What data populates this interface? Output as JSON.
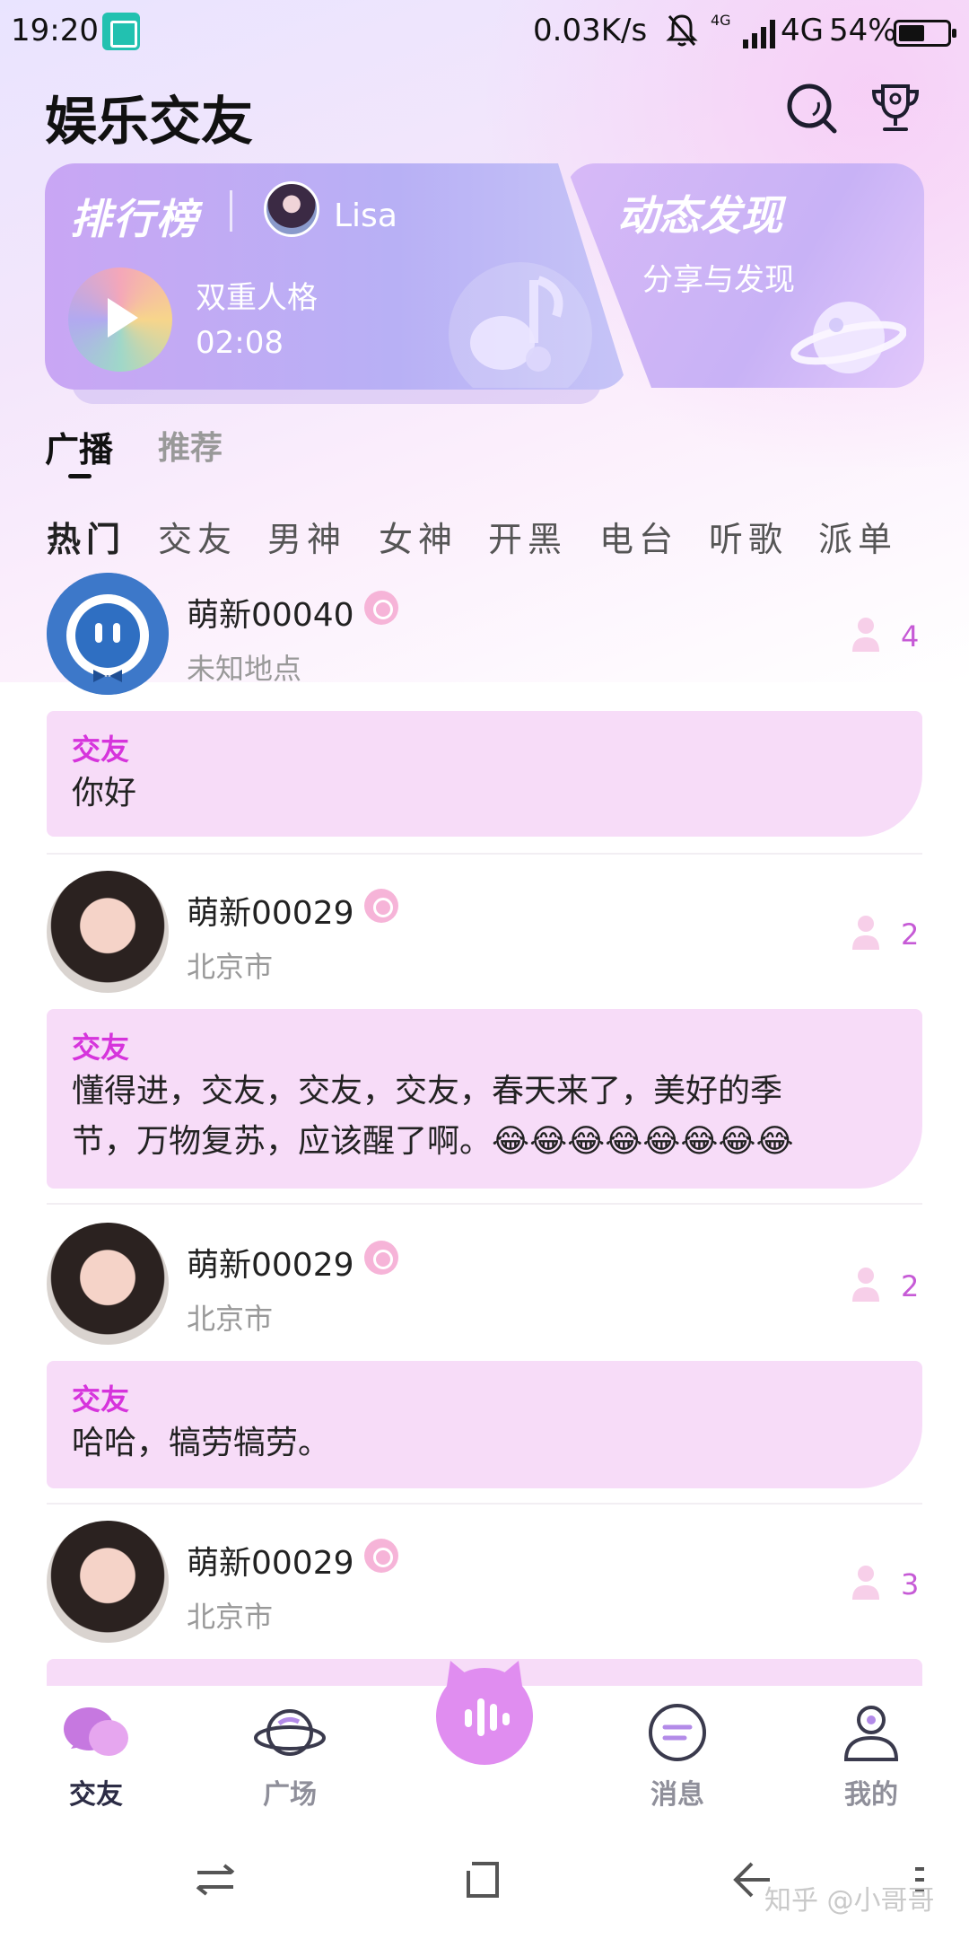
{
  "status_bar": {
    "time": "19:20",
    "net_speed": "0.03K/s",
    "net_small": "4G",
    "network": "4G",
    "battery_pct": "54%",
    "battery_level": 0.54
  },
  "header": {
    "title": "娱乐交友",
    "icons": [
      "search-icon",
      "trophy-icon"
    ]
  },
  "banner": {
    "rank": {
      "title": "排行榜",
      "user": "Lisa",
      "song": "双重人格",
      "duration": "02:08"
    },
    "discover": {
      "title": "动态发现",
      "subtitle": "分享与发现"
    }
  },
  "tabs": [
    {
      "label": "广播",
      "active": true
    },
    {
      "label": "推荐",
      "active": false
    }
  ],
  "categories": [
    "热门",
    "交友",
    "男神",
    "女神",
    "开黑",
    "电台",
    "听歌",
    "派单"
  ],
  "posts": [
    {
      "username": "萌新00040",
      "location": "未知地点",
      "count": "4",
      "tag": "交友",
      "text": "你好"
    },
    {
      "username": "萌新00029",
      "location": "北京市",
      "count": "2",
      "tag": "交友",
      "text_line1": "懂得进，交友，交友，交友，春天来了，美好的季",
      "text_line2": "节，万物复苏，应该醒了啊。😂😂😂😂😂😂😂😂"
    },
    {
      "username": "萌新00029",
      "location": "北京市",
      "count": "2",
      "tag": "交友",
      "text": "哈哈，犒劳犒劳。"
    },
    {
      "username": "萌新00029",
      "location": "北京市",
      "count": "3"
    }
  ],
  "bottom_nav": [
    {
      "label": "交友",
      "icon": "chat-bubbles-icon",
      "active": true
    },
    {
      "label": "广场",
      "icon": "planet-icon",
      "active": false
    },
    {
      "label": "",
      "icon": "voice-cat-icon",
      "active": false
    },
    {
      "label": "消息",
      "icon": "message-icon",
      "active": false
    },
    {
      "label": "我的",
      "icon": "profile-icon",
      "active": false
    }
  ],
  "watermark": "知乎 @小哥哥",
  "colors": {
    "accent": "#d634dc",
    "bubble": "#f7dcf8",
    "count": "#c65ad6",
    "card": "#c9a6f4"
  }
}
